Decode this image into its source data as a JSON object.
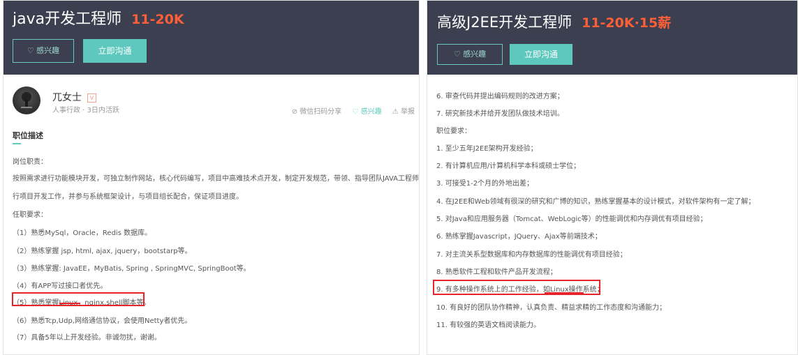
{
  "left": {
    "title": "java开发工程师",
    "salary": "11-20K",
    "interest_btn": "♡ 感兴趣",
    "chat_btn": "立即沟通",
    "recruiter": {
      "name": "兀女士",
      "badge": "V",
      "info": "人事行政 · 3日内活跃"
    },
    "actions": {
      "share": "⊘ 微信扫码分享",
      "interest": "♡ 感兴趣",
      "report": "⚠ 举报"
    },
    "section_title": "职位描述",
    "lines": [
      "岗位职责：",
      "按照需求进行功能模块开发，可独立制作网站，核心代码编写，项目中高难技术点开发，制定开发规范，带领、指导团队JAVA工程师进",
      "行项目开发工作，并参与系统框架设计，与项目组长配合，保证项目进度。",
      "任职要求：",
      "（1）熟悉MySql，Oracle，Redis 数据库。",
      "（2）熟练掌握 jsp, html, ajax, jquery，bootstarp等。",
      "（3）熟练掌握: JavaEE，MyBatis, Spring , SpringMVC, SpringBoot等。",
      "（4）有APP写过接口者优先。",
      "（5）熟悉掌握Linux，nginx,shell脚本等。",
      "（6）熟悉Tcp,Udp,网络通信协议，会使用Netty者优先。",
      "（7）具备5年以上开发经验。非诚勿扰，谢谢。"
    ]
  },
  "right": {
    "title": "高级J2EE开发工程师",
    "salary": "11-20K·15薪",
    "interest_btn": "♡ 感兴趣",
    "chat_btn": "立即沟通",
    "lines": [
      "6. 审查代码并提出编码规则的改进方案；",
      "7. 研究新技术并给开发团队做技术培训。",
      "职位要求：",
      "1. 至少五年J2EE架构开发经验；",
      "2. 有计算机应用/计算机科学本科或硕士学位；",
      "3. 可接受1-2个月的外地出差；",
      "4. 在J2EE和Web领域有很深的研究和广博的知识，熟练掌握基本的设计模式，对软件架构有一定了解；",
      "5. 对Java和应用服务器（Tomcat、WebLogic等）的性能调优和内存调优有项目经验；",
      "6. 熟练掌握Javascript，JQuery、Ajax等前端技术；",
      "7. 对主流关系型数据库和内存数据库的性能调优有项目经验；",
      "8. 熟悉软件工程和软件产品开发流程；",
      "9. 有多种操作系统上的工作经验，如Linux操作系统；",
      "10. 有良好的团队协作精神，认真负责、精益求精的工作态度和沟通能力；",
      "11. 有较强的英语文档阅读能力。"
    ]
  }
}
